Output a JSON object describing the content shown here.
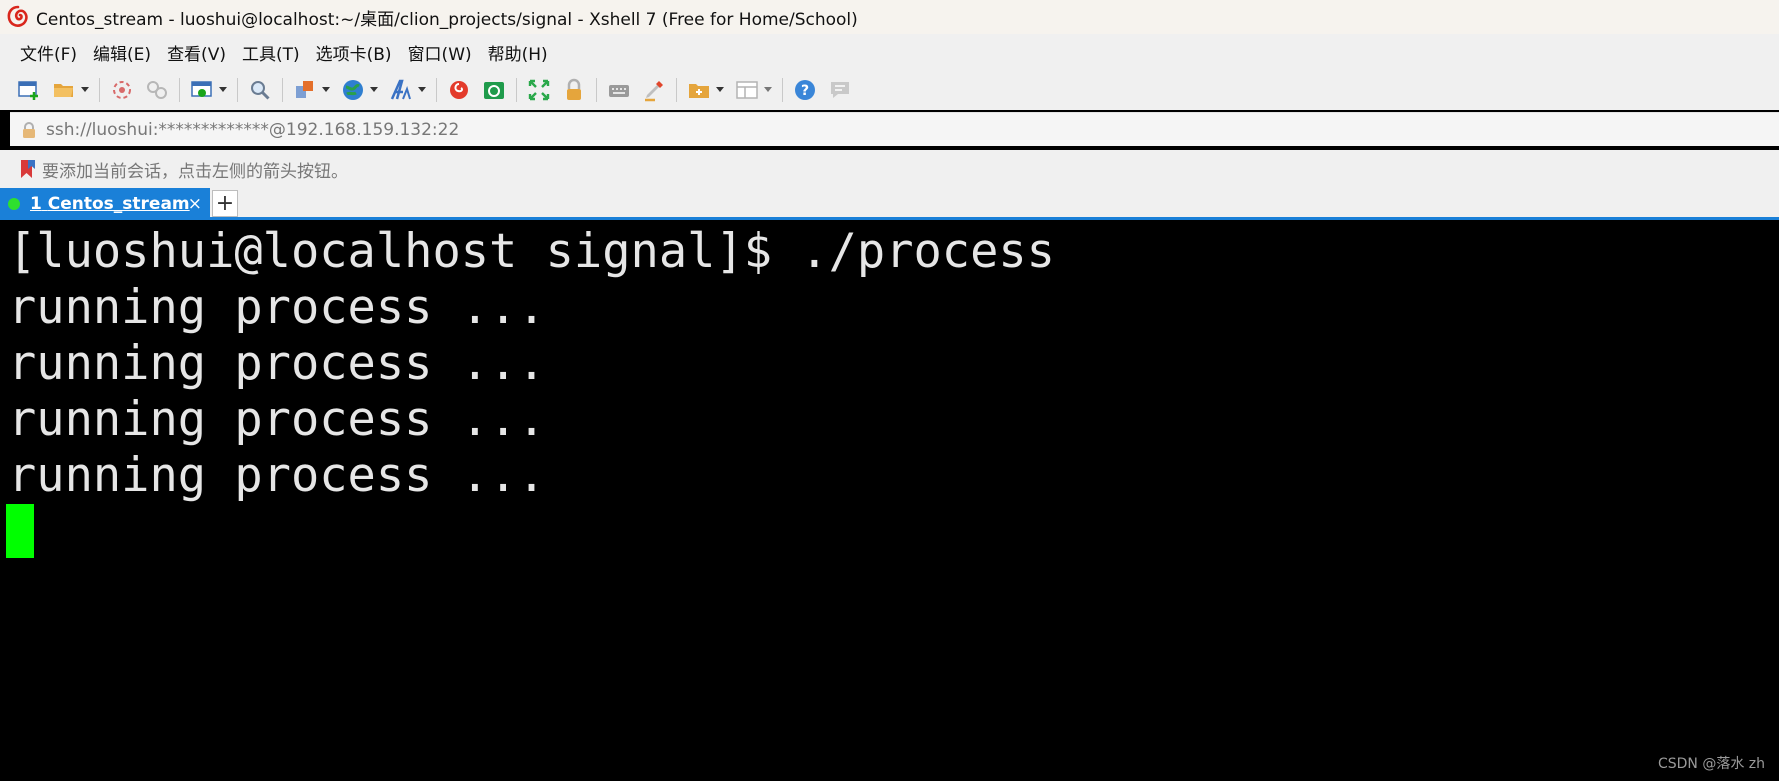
{
  "window": {
    "title": "Centos_stream - luoshui@localhost:~/桌面/clion_projects/signal - Xshell 7 (Free for Home/School)"
  },
  "menu": {
    "items": [
      "文件(F)",
      "编辑(E)",
      "查看(V)",
      "工具(T)",
      "选项卡(B)",
      "窗口(W)",
      "帮助(H)"
    ]
  },
  "toolbar": {
    "icons": [
      "new-session-icon",
      "open-folder-icon",
      "disconnect-icon",
      "reconnect-icon",
      "properties-icon",
      "find-icon",
      "transfer-icon",
      "globe-icon",
      "font-icon",
      "xshell-icon",
      "xftp-icon",
      "fullscreen-icon",
      "lock-icon",
      "keyboard-icon",
      "highlight-icon",
      "add-tab-icon",
      "layout-icon",
      "help-icon",
      "chat-icon"
    ]
  },
  "address": {
    "value": "ssh://luoshui:*************@192.168.159.132:22"
  },
  "hint": {
    "text": "要添加当前会话，点击左侧的箭头按钮。"
  },
  "tabs": [
    {
      "number": "1",
      "label": "Centos_stream",
      "status_color": "#2ee02e"
    }
  ],
  "terminal": {
    "lines": [
      "[luoshui@localhost signal]$ ./process",
      "running process ...",
      "running process ...",
      "running process ...",
      "running process ..."
    ],
    "cursor_color": "#00ff00"
  },
  "watermark": "CSDN @落水 zh",
  "colors": {
    "accent": "#1a80d8",
    "terminal_bg": "#000000",
    "terminal_fg": "#e6e6e6"
  }
}
